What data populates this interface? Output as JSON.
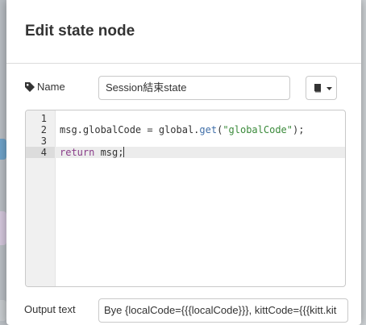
{
  "dialog": {
    "title": "Edit state node"
  },
  "name_field": {
    "label": "Name",
    "value": "Session結束state",
    "icon": "tag-icon"
  },
  "library_button": {
    "icon": "book-icon",
    "caret_icon": "chevron-down-icon"
  },
  "code_editor": {
    "lines": [
      {
        "number": "1",
        "text": ""
      },
      {
        "number": "2",
        "text": "msg.globalCode = global.get(\"globalCode\");"
      },
      {
        "number": "3",
        "text": ""
      },
      {
        "number": "4",
        "text": "return msg;"
      }
    ],
    "active_line": "4",
    "syntax_colors": {
      "keyword": "#8a3e8a",
      "function": "#3f6ea8",
      "string": "#3a8a3a"
    }
  },
  "output_field": {
    "label": "Output text",
    "value": "Bye {localCode={{{localCode}}}, kittCode={{{kitt.kit"
  }
}
